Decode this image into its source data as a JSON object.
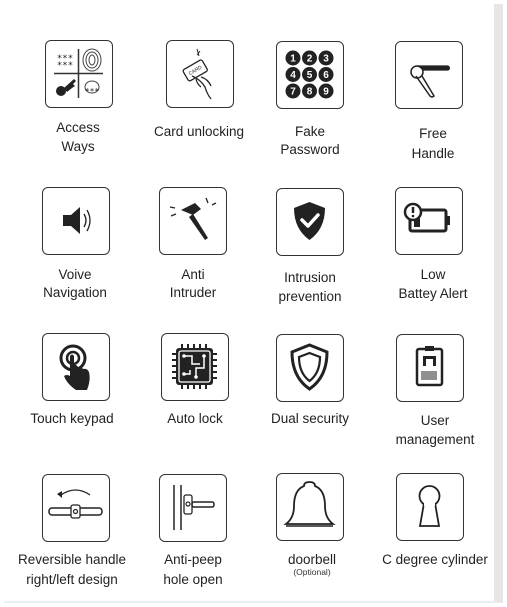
{
  "features": [
    {
      "id": "access",
      "line1": "Access",
      "line2": "Ways",
      "icon": "fingerprint-keypad-key-icon"
    },
    {
      "id": "card",
      "line1": "Card unlocking",
      "line2": "",
      "icon": "card-hand-icon"
    },
    {
      "id": "fake",
      "line1": "Fake",
      "line2": "Password",
      "icon": "number-keypad-icon"
    },
    {
      "id": "free",
      "line1": "Free",
      "line2": "Handle",
      "icon": "handle-icon"
    },
    {
      "id": "voice",
      "line1": "Voive",
      "line2": "Navigation",
      "icon": "speaker-icon"
    },
    {
      "id": "anti",
      "line1": "Anti",
      "line2": "Intruder",
      "icon": "hammer-icon"
    },
    {
      "id": "intrusion",
      "line1": "Intrusion",
      "line2": "prevention",
      "icon": "shield-check-icon"
    },
    {
      "id": "battery",
      "line1": "Low",
      "line2": "Battey Alert",
      "icon": "low-battery-icon"
    },
    {
      "id": "touch",
      "line1": "Touch keypad",
      "line2": "",
      "icon": "touch-finger-icon"
    },
    {
      "id": "autolock",
      "line1": "Auto lock",
      "line2": "",
      "icon": "chip-icon"
    },
    {
      "id": "dual",
      "line1": "Dual security",
      "line2": "",
      "icon": "double-shield-icon"
    },
    {
      "id": "user",
      "line1": "User",
      "line2": "management",
      "icon": "id-badge-icon"
    },
    {
      "id": "reversible",
      "line1": "Reversible handle",
      "line2": "right/left design",
      "icon": "reversible-handle-icon"
    },
    {
      "id": "peep",
      "line1": "Anti-peep",
      "line2": "hole open",
      "icon": "peep-hole-handle-icon"
    },
    {
      "id": "doorbell",
      "line1": "doorbell",
      "line2": "",
      "sub": "(Optional)",
      "icon": "bell-icon"
    },
    {
      "id": "cylinder",
      "line1": "C degree cylinder",
      "line2": "",
      "icon": "keyhole-icon"
    }
  ]
}
